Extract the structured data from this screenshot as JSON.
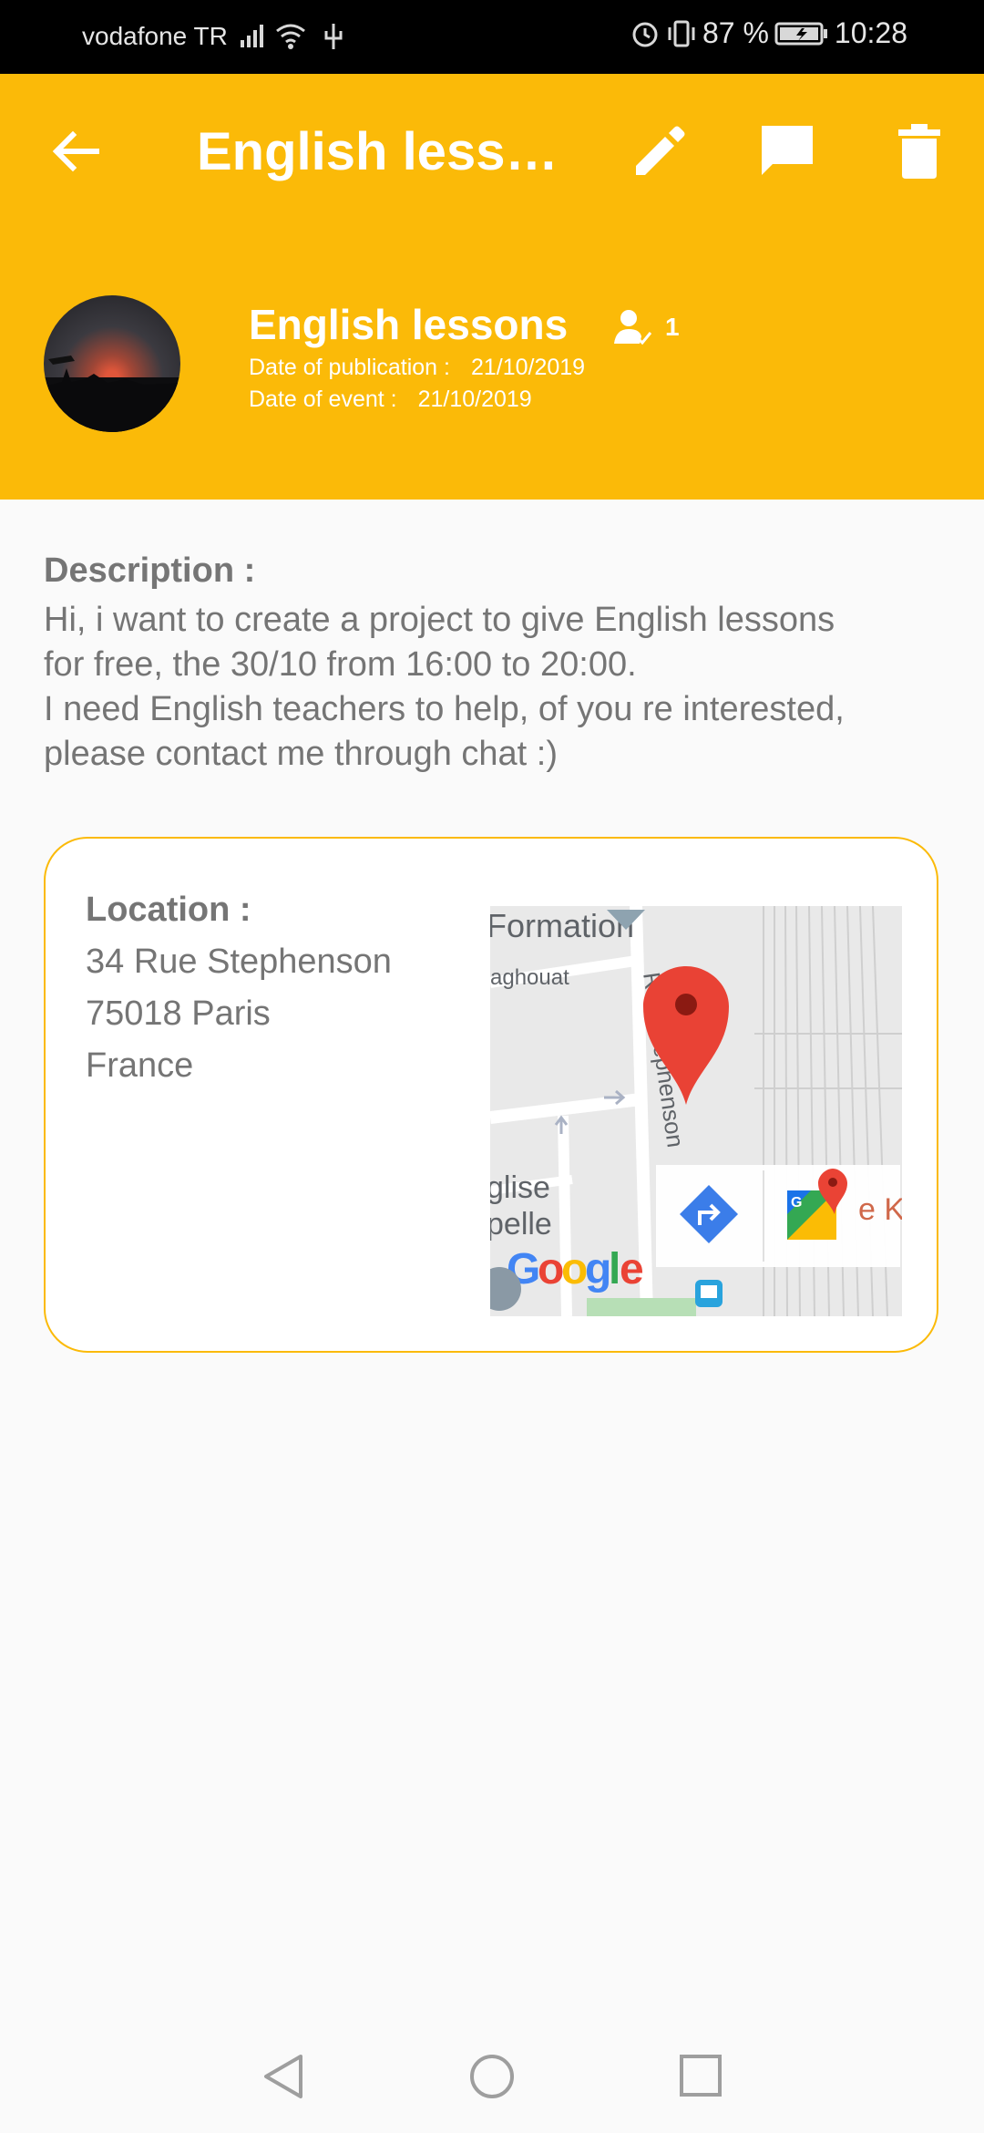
{
  "status_bar": {
    "carrier": "vodafone TR",
    "battery": "87 %",
    "time": "10:28"
  },
  "app_bar": {
    "title": "English lessons"
  },
  "event": {
    "name": "English lessons",
    "members_count": "1",
    "publication_label": "Date of publication :",
    "publication_date": "21/10/2019",
    "event_label": "Date of event :",
    "event_date": "21/10/2019"
  },
  "description": {
    "label": "Description :",
    "line1": "Hi, i want to create a project to give English lessons",
    "line2": "for free, the 30/10 from 16:00 to 20:00.",
    "line3": "I need English teachers to help, of you re interested,",
    "line4": "please contact me through chat :)"
  },
  "location": {
    "label": "Location :",
    "street": "34 Rue Stephenson",
    "city": "75018 Paris",
    "country": "France"
  },
  "map": {
    "labels": [
      "Formation",
      "aghouat",
      "Rue Stephenson",
      "glise",
      "pelle",
      "e Ku"
    ],
    "brand": "Google"
  },
  "colors": {
    "accent": "#fbba08",
    "text_gray": "#757575"
  }
}
